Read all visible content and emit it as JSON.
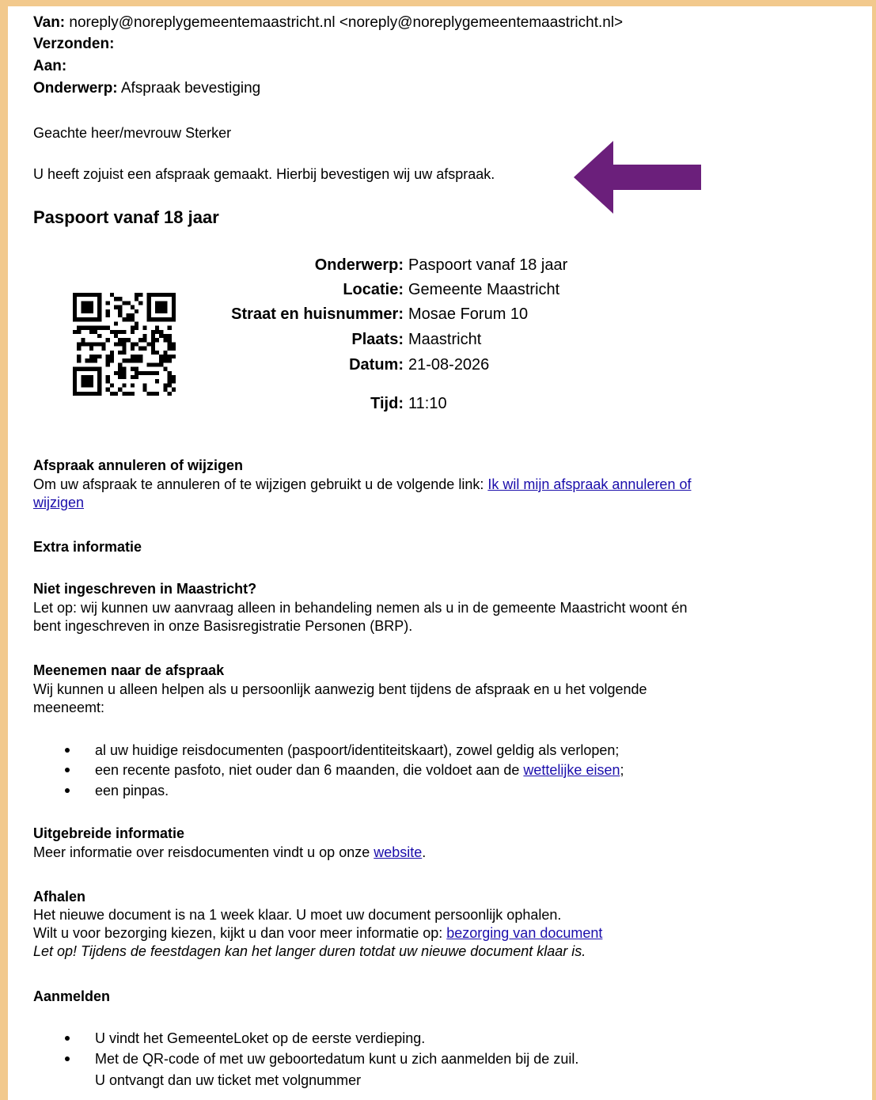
{
  "email": {
    "from_label": "Van:",
    "from_value": "noreply@noreplygemeentemaastricht.nl <noreply@noreplygemeentemaastricht.nl>",
    "sent_label": "Verzonden:",
    "to_label": "Aan:",
    "subject_label": "Onderwerp:",
    "subject_value": "Afspraak bevestiging"
  },
  "greeting": "Geachte heer/mevrouw Sterker",
  "intro": "U heeft zojuist een afspraak gemaakt. Hierbij bevestigen wij uw afspraak.",
  "title": "Paspoort vanaf 18 jaar",
  "details": {
    "subject_label": "Onderwerp:",
    "subject_value": "Paspoort vanaf 18 jaar",
    "location_label": "Locatie:",
    "location_value": "Gemeente Maastricht",
    "street_label": "Straat en huisnummer:",
    "street_value": "Mosae Forum 10",
    "city_label": "Plaats:",
    "city_value": "Maastricht",
    "date_label": "Datum:",
    "date_value": "21-08-2026",
    "time_label": "Tijd:",
    "time_value": "11:10"
  },
  "cancel": {
    "heading": "Afspraak annuleren of wijzigen",
    "text": "Om uw afspraak te annuleren of te wijzigen gebruikt u de volgende link: ",
    "link_line1": "Ik wil mijn afspraak annuleren of",
    "link_line2": "wijzigen"
  },
  "extra_heading": "Extra informatie",
  "not_registered": {
    "heading": "Niet ingeschreven in Maastricht?",
    "line1": "Let op: wij kunnen uw aanvraag alleen in behandeling nemen als u in de gemeente Maastricht woont én",
    "line2": "bent ingeschreven in onze Basisregistratie Personen (BRP)."
  },
  "bring": {
    "heading": "Meenemen naar de afspraak",
    "line1": "Wij kunnen u alleen helpen als u persoonlijk aanwezig bent tijdens de afspraak en u het volgende",
    "line2": "meeneemt:",
    "item1": "al uw huidige reisdocumenten (paspoort/identiteitskaart), zowel geldig als verlopen;",
    "item2_text": "een recente pasfoto, niet ouder dan 6 maanden, die voldoet aan de ",
    "item2_link": "wettelijke eisen",
    "item2_end": ";",
    "item3": "een pinpas."
  },
  "more_info": {
    "heading": "Uitgebreide informatie",
    "text": "Meer informatie over reisdocumenten vindt u op onze ",
    "link": "website",
    "end": "."
  },
  "pickup": {
    "heading": "Afhalen",
    "line1": "Het nieuwe document is na 1 week klaar. U moet uw document persoonlijk ophalen.",
    "line2_text": "Wilt u voor bezorging kiezen, kijkt u dan voor meer informatie op: ",
    "line2_link": "bezorging van document",
    "line3": "Let op! Tijdens de feestdagen kan het langer duren totdat uw nieuwe document klaar is."
  },
  "signin": {
    "heading": "Aanmelden",
    "item1": "U vindt het GemeenteLoket op de eerste verdieping.",
    "item2": "Met de QR-code of met uw geboortedatum kunt u zich aanmelden bij de zuil.",
    "item2_cont": "U ontvangt dan uw ticket met volgnummer"
  },
  "colors": {
    "border": "#f2c98d",
    "link": "#1a0dab",
    "arrow": "#6b1f7b"
  },
  "icons": {
    "qr": "qr-code-icon",
    "arrow": "left-arrow-icon"
  }
}
